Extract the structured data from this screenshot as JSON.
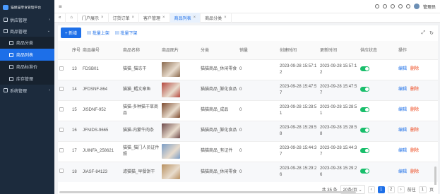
{
  "app": {
    "title": "猫娘猫零食管理平台"
  },
  "sidebar": {
    "groups": [
      {
        "label": "供应管理",
        "icon": "store-icon",
        "expanded": false
      },
      {
        "label": "商品管理",
        "icon": "grid-icon",
        "expanded": true,
        "items": [
          {
            "label": "商品分类",
            "icon": "category-icon"
          },
          {
            "label": "商品列表",
            "icon": "list-icon",
            "active": true
          },
          {
            "label": "商品标准价",
            "icon": "price-icon"
          },
          {
            "label": "库存管理",
            "icon": "box-icon"
          }
        ]
      },
      {
        "label": "系统管理",
        "icon": "gear-icon",
        "expanded": false
      }
    ]
  },
  "header": {
    "user": "管理员"
  },
  "tabs": [
    {
      "label": "门户展示",
      "active": false
    },
    {
      "label": "订货订单",
      "active": false
    },
    {
      "label": "客户管理",
      "active": false
    },
    {
      "label": "商品列表",
      "active": true
    },
    {
      "label": "商品分类",
      "active": false
    }
  ],
  "toolbar": {
    "add": "+ 新增",
    "batch_up": "批量上架",
    "batch_down": "批量下架"
  },
  "table": {
    "headers": [
      "",
      "序号",
      "商品编号",
      "商品名称",
      "商品图片",
      "分类",
      "销量",
      "创建时间",
      "更新时间",
      "供应状态",
      "操作"
    ],
    "edit": "编辑",
    "delete": "删除",
    "rows": [
      {
        "no": "13",
        "code": "FDSB01",
        "name": "猫猫_猫冻干",
        "cat": "猫猫商品_休闲零食",
        "sales": "0",
        "created": "2023-09-28 15:57:12",
        "updated": "2023-09-28 15:57:12",
        "img": "#8a6a4e"
      },
      {
        "no": "14",
        "code": "JFDSNF-864",
        "name": "猫猫_鳕文章鱼",
        "cat": "猫猫商品_膨化食品",
        "sales": "0",
        "created": "2023-09-28 15:47:57",
        "updated": "2023-09-28 15:47:57",
        "img": "#b5483f"
      },
      {
        "no": "15",
        "code": "JISDNF-952",
        "name": "猫猫-多种猫干草商品",
        "cat": "猫猫商品_成品",
        "sales": "0",
        "created": "2023-09-28 15:28:51",
        "updated": "2023-09-28 15:28:51",
        "img": "#7c4a2e"
      },
      {
        "no": "16",
        "code": "JFNIDS-9665",
        "name": "猫猫-内蒙牛肉条",
        "cat": "猫猫商品_膨化食品",
        "sales": "0",
        "created": "2023-09-28 15:28:58",
        "updated": "2023-09-28 15:28:58",
        "img": "#6e4a4a"
      },
      {
        "no": "17",
        "code": "JUINFA_258621",
        "name": "猫猫_猫门人员证件照",
        "cat": "猫猫商品_有证件",
        "sales": "0",
        "created": "2023-09-28 15:44:37",
        "updated": "2023-09-28 15:44:37",
        "img": "#7a9cc6"
      },
      {
        "no": "18",
        "code": "JIASF-84123",
        "name": "滤猫猫_早餐饼干",
        "cat": "猫猫商品_休闲零食",
        "sales": "0",
        "created": "2023-09-28 15:29:26",
        "updated": "2023-09-28 15:29:26",
        "img": "#b89060"
      }
    ]
  },
  "pager": {
    "total": "共 35 条",
    "size": "20条/页",
    "pages": [
      "1",
      "2"
    ],
    "goto": "前往",
    "page_input": "1",
    "page_unit": "页"
  }
}
